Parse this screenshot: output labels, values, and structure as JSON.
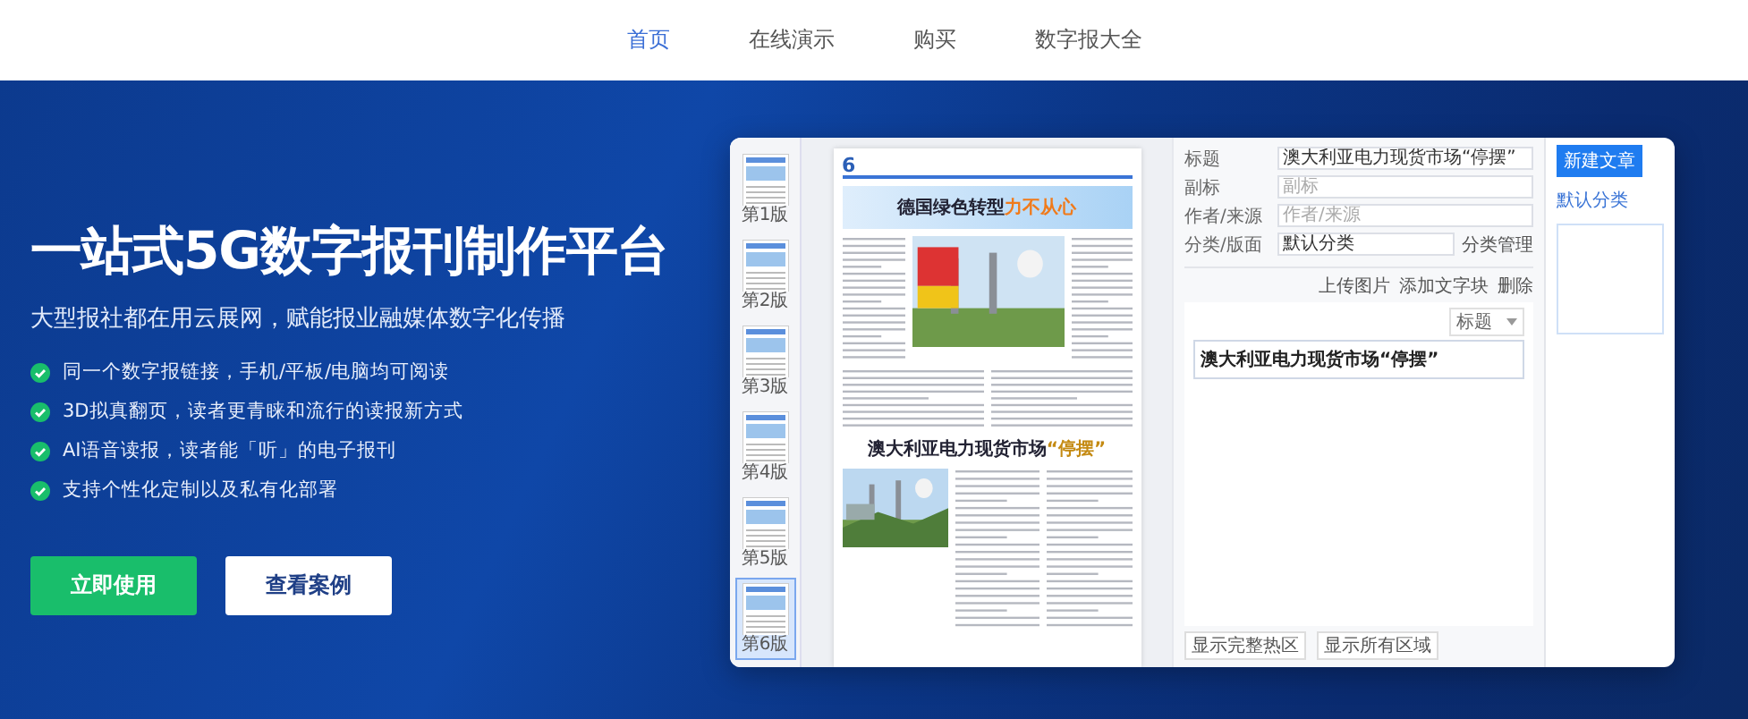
{
  "nav": {
    "items": [
      {
        "label": "首页",
        "selected": true
      },
      {
        "label": "在线演示",
        "selected": false
      },
      {
        "label": "购买",
        "selected": false
      },
      {
        "label": "数字报大全",
        "selected": false
      }
    ]
  },
  "hero": {
    "title": "一站式5G数字报刊制作平台",
    "subtitle": "大型报社都在用云展网，赋能报业融媒体数字化传播",
    "features": [
      "同一个数字报链接，手机/平板/电脑均可阅读",
      "3D拟真翻页，读者更青睐和流行的读报新方式",
      "AI语音读报，读者能「听」的电子报刊",
      "支持个性化定制以及私有化部署"
    ],
    "buttons": [
      {
        "label": "立即使用",
        "kind": "primary"
      },
      {
        "label": "查看案例",
        "kind": "secondary"
      }
    ]
  },
  "app": {
    "thumbnails": [
      {
        "label": "第1版",
        "selected": false
      },
      {
        "label": "第2版",
        "selected": false
      },
      {
        "label": "第3版",
        "selected": false
      },
      {
        "label": "第4版",
        "selected": false
      },
      {
        "label": "第5版",
        "selected": false
      },
      {
        "label": "第6版",
        "selected": true
      }
    ],
    "page": {
      "section_number": "6",
      "headline_1": {
        "main": "德国绿色转型",
        "accent": "力不从心"
      },
      "headline_2": {
        "main": "澳大利亚电力现货市场",
        "accent": "“停摆”"
      }
    },
    "fields": [
      {
        "label": "标题",
        "value": "澳大利亚电力现货市场“停摆”"
      },
      {
        "label": "副标",
        "placeholder": "副标"
      },
      {
        "label": "作者/来源",
        "placeholder": "作者/来源"
      },
      {
        "label": "分类/版面",
        "value": "默认分类"
      }
    ],
    "category_button": "分类管理",
    "toolbar": [
      "上传图片",
      "添加文字块",
      "删除"
    ],
    "block_type": "标题",
    "block_text": "澳大利亚电力现货市场“停摆”",
    "bottom_buttons": [
      "显示完整热区",
      "显示所有区域"
    ],
    "new_button": "新建文章",
    "category_label": "默认分类"
  }
}
